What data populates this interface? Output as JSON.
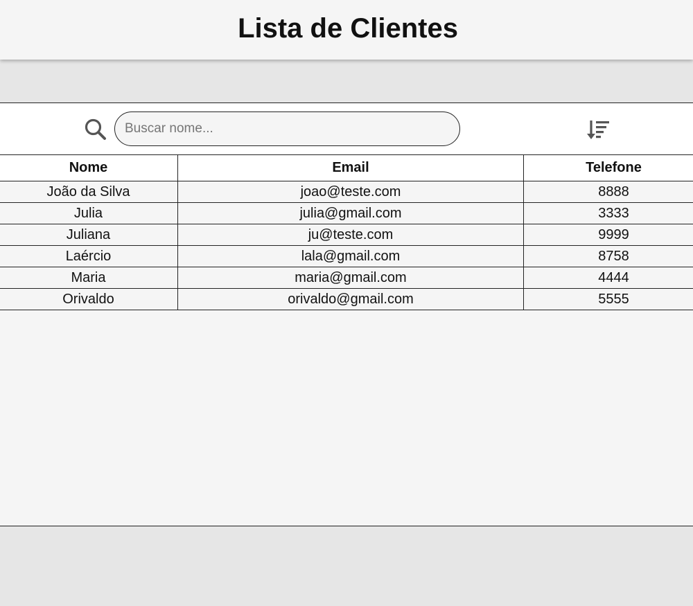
{
  "header": {
    "title": "Lista de Clientes"
  },
  "toolbar": {
    "search_icon": "search-icon",
    "search_placeholder": "Buscar nome...",
    "search_value": "",
    "sort_icon": "sort-descending-icon"
  },
  "table": {
    "columns": [
      "Nome",
      "Email",
      "Telefone",
      ""
    ],
    "rows": [
      {
        "nome": "João da Silva",
        "email": "joao@teste.com",
        "telefone": "8888"
      },
      {
        "nome": "Julia",
        "email": "julia@gmail.com",
        "telefone": "3333"
      },
      {
        "nome": "Juliana",
        "email": "ju@teste.com",
        "telefone": "9999"
      },
      {
        "nome": "Laércio",
        "email": "lala@gmail.com",
        "telefone": "8758"
      },
      {
        "nome": "Maria",
        "email": "maria@gmail.com",
        "telefone": "4444"
      },
      {
        "nome": "Orivaldo",
        "email": "orivaldo@gmail.com",
        "telefone": "5555"
      }
    ]
  },
  "colors": {
    "background": "#e6e6e6",
    "panel": "#f5f5f5",
    "icon": "#555555",
    "border": "#222222"
  }
}
